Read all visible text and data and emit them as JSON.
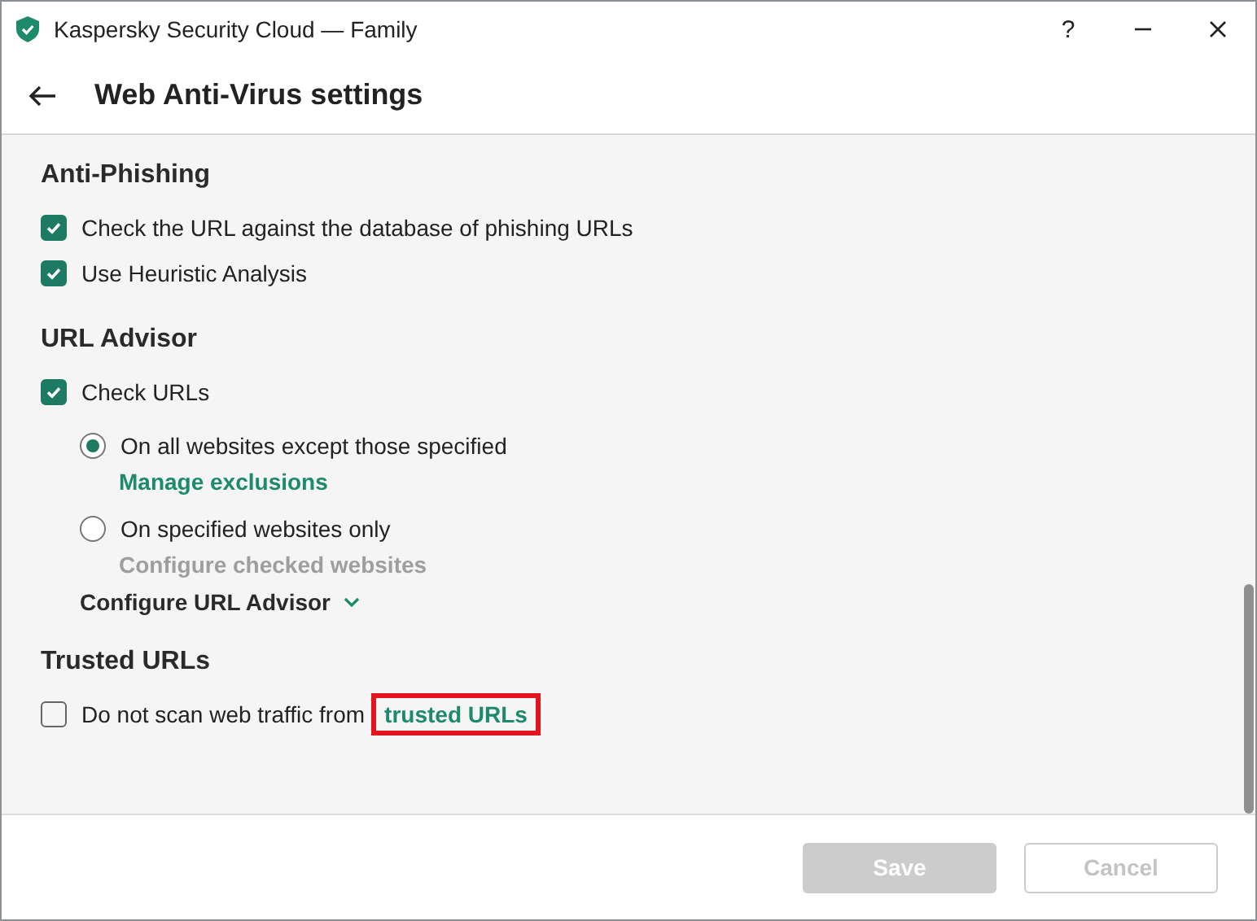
{
  "window": {
    "title": "Kaspersky Security Cloud — Family",
    "help": "?"
  },
  "header": {
    "title": "Web Anti-Virus settings"
  },
  "sections": [
    {
      "title": "Anti-Phishing",
      "items": [
        {
          "kind": "checkbox",
          "label": "Check the URL against the database of phishing URLs",
          "checked": true
        },
        {
          "kind": "checkbox",
          "label": "Use Heuristic Analysis",
          "checked": true
        }
      ]
    },
    {
      "title": "URL Advisor",
      "items": [
        {
          "kind": "checkbox",
          "label": "Check URLs",
          "checked": true
        },
        {
          "kind": "radio",
          "label": "On all websites except those specified",
          "selected": true,
          "link": {
            "text": "Manage exclusions",
            "disabled": false
          }
        },
        {
          "kind": "radio",
          "label": "On specified websites only",
          "selected": false,
          "link": {
            "text": "Configure checked websites",
            "disabled": true
          }
        },
        {
          "kind": "expander",
          "label": "Configure URL Advisor",
          "expanded": false
        }
      ]
    },
    {
      "title": "Trusted URLs",
      "items": [
        {
          "kind": "checkbox",
          "label": "Do not scan web traffic from",
          "checked": false,
          "link": {
            "text": "trusted URLs",
            "disabled": false,
            "highlighted": true
          }
        }
      ]
    }
  ],
  "buttons": [
    {
      "label": "Save",
      "kind": "primary",
      "disabled": true
    },
    {
      "label": "Cancel",
      "kind": "secondary",
      "disabled": true
    }
  ]
}
